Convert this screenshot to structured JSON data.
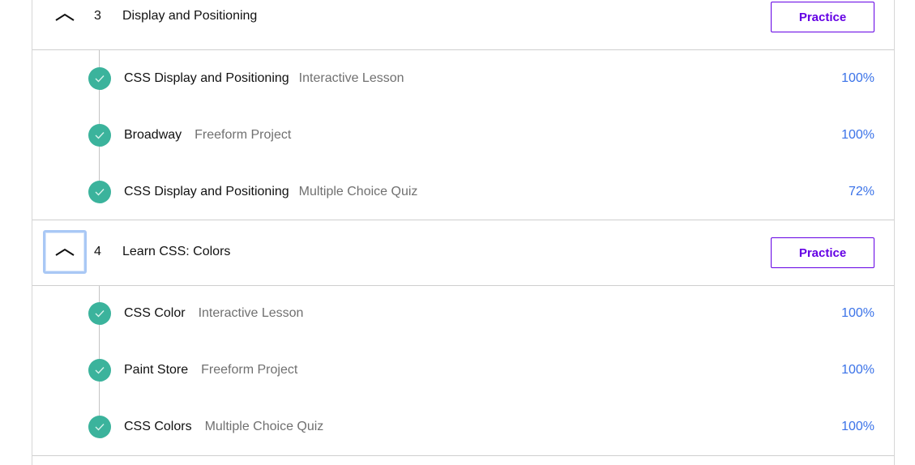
{
  "modules": [
    {
      "number": "3",
      "title": "Display and Positioning",
      "practice_label": "Practice",
      "toggle_icon": "chevron-up-icon",
      "lessons": [
        {
          "title": "CSS Display and Positioning",
          "type": "Interactive Lesson",
          "percent": "100%",
          "status": "complete"
        },
        {
          "title": "Broadway",
          "type": "Freeform Project",
          "percent": "100%",
          "status": "complete"
        },
        {
          "title": "CSS Display and Positioning",
          "type": "Multiple Choice Quiz",
          "percent": "72%",
          "status": "complete"
        }
      ]
    },
    {
      "number": "4",
      "title": "Learn CSS: Colors",
      "practice_label": "Practice",
      "toggle_icon": "chevron-up-icon",
      "toggle_focused": true,
      "lessons": [
        {
          "title": "CSS Color",
          "type": "Interactive Lesson",
          "percent": "100%",
          "status": "complete"
        },
        {
          "title": "Paint Store",
          "type": "Freeform Project",
          "percent": "100%",
          "status": "complete"
        },
        {
          "title": "CSS Colors",
          "type": "Multiple Choice Quiz",
          "percent": "100%",
          "status": "complete"
        }
      ]
    }
  ],
  "colors": {
    "accent_purple": "#6400e4",
    "check_green": "#3bb39c",
    "percent_blue": "#3a72e8",
    "focus_ring": "#a9c8f5"
  }
}
